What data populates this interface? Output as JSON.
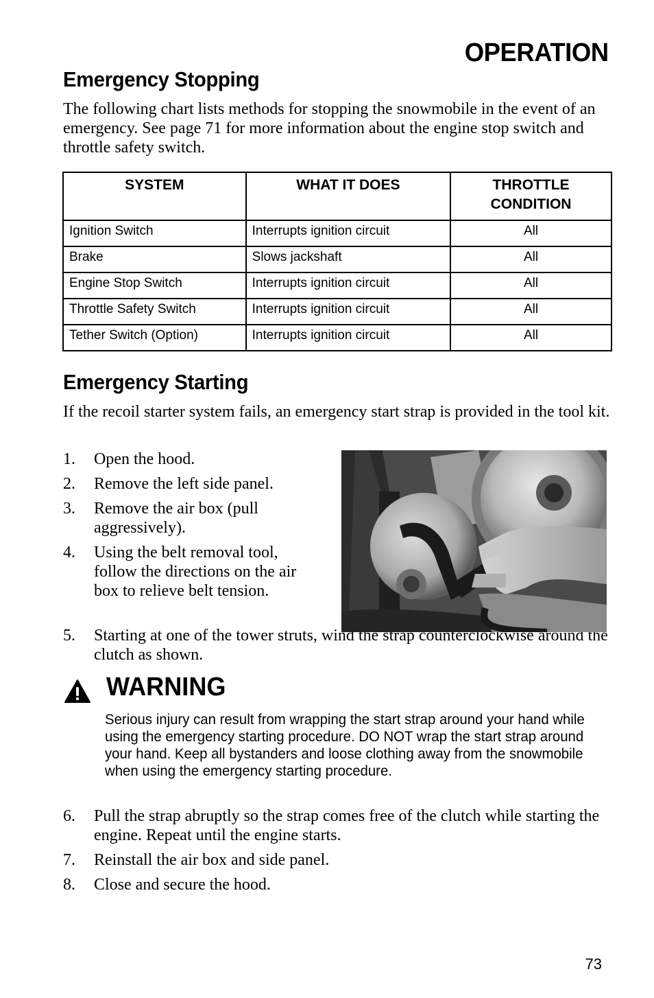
{
  "header": {
    "section": "OPERATION"
  },
  "stopping": {
    "title": "Emergency Stopping",
    "intro": "The following chart lists methods for stopping the snowmobile in the event of an emergency.  See page 71 for more information about the engine stop switch and throttle safety switch.",
    "table": {
      "headers": [
        "SYSTEM",
        "WHAT IT DOES",
        "THROTTLE CONDITION"
      ],
      "rows": [
        [
          "Ignition Switch",
          "Interrupts ignition circuit",
          "All"
        ],
        [
          "Brake",
          "Slows jackshaft",
          "All"
        ],
        [
          "Engine Stop Switch",
          "Interrupts ignition circuit",
          "All"
        ],
        [
          "Throttle Safety Switch",
          "Interrupts ignition circuit",
          "All"
        ],
        [
          "Tether Switch (Option)",
          "Interrupts ignition circuit",
          "All"
        ]
      ]
    }
  },
  "starting": {
    "title": "Emergency Starting",
    "intro": "If the recoil starter system fails, an emergency start strap is provided in the tool kit.",
    "steps_a": [
      {
        "num": "1.",
        "text": "Open the hood."
      },
      {
        "num": "2.",
        "text": "Remove the left side panel."
      },
      {
        "num": "3.",
        "text": "Remove the air box (pull aggressively)."
      },
      {
        "num": "4.",
        "text": "Using the belt removal tool, follow the directions on the air box to relieve belt tension."
      },
      {
        "num": "5.",
        "text": "Starting at one of the tower struts, wind the strap counterclockwise around the clutch as shown."
      }
    ],
    "photo_alt": "Hand winding start strap counterclockwise around clutch",
    "warning": {
      "icon": "warning-triangle-icon",
      "title": "WARNING",
      "body": "Serious injury can result from wrapping the start strap around your hand while using the emergency starting procedure.  DO NOT wrap the start strap around your hand.  Keep all bystanders and loose clothing away from the snowmobile when using the emergency starting procedure."
    },
    "steps_b": [
      {
        "num": "6.",
        "text": "Pull the strap abruptly so the strap comes free of the clutch while starting the engine.  Repeat until the engine starts."
      },
      {
        "num": "7.",
        "text": "Reinstall the air box and side panel."
      },
      {
        "num": "8.",
        "text": "Close and secure the hood."
      }
    ]
  },
  "footer": {
    "page_number": "73"
  }
}
